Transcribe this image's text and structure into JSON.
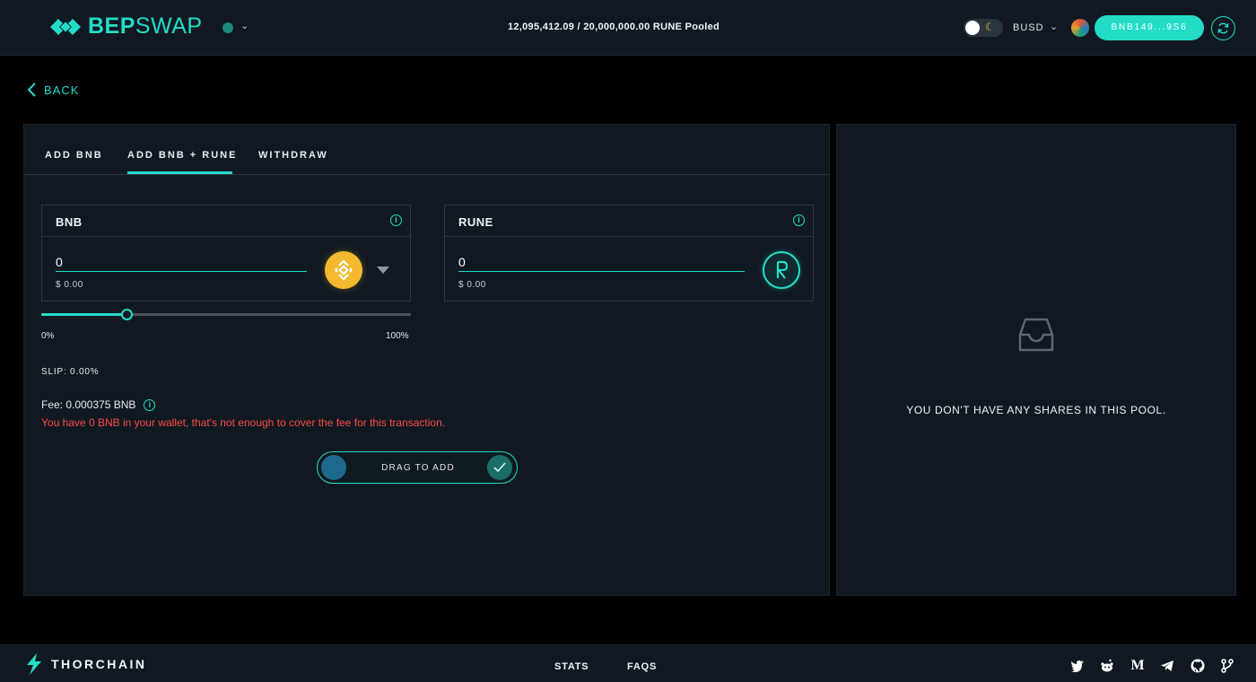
{
  "header": {
    "logo_bep": "BEP",
    "logo_swap": "SWAP",
    "pooled_text": "12,095,412.09 / 20,000,000.00 RUNE Pooled",
    "currency": "BUSD",
    "wallet_address": "BNB149...9S6"
  },
  "nav": {
    "back_label": "BACK"
  },
  "tabs": [
    {
      "label": "ADD BNB"
    },
    {
      "label": "ADD BNB + RUNE",
      "active": true
    },
    {
      "label": "WITHDRAW"
    }
  ],
  "bnb_card": {
    "title": "BNB",
    "amount": "0",
    "usd": "$ 0.00",
    "icon": "bnb-coin-icon"
  },
  "rune_card": {
    "title": "RUNE",
    "amount": "0",
    "usd": "$ 0.00",
    "icon": "rune-coin-icon"
  },
  "slider": {
    "min_label": "0%",
    "max_label": "100%",
    "value_fraction": 0.23
  },
  "slip_text": "SLIP: 0.00%",
  "fee": {
    "text": "Fee: 0.000375 BNB",
    "warning": "You have 0 BNB in your wallet, that's not enough to cover the fee for this transaction."
  },
  "drag_button": {
    "label": "DRAG TO ADD"
  },
  "shares_panel": {
    "empty_text": "YOU DON'T HAVE ANY SHARES IN THIS POOL.",
    "icon": "inbox-icon"
  },
  "footer": {
    "brand": "THORCHAIN",
    "links": [
      "STATS",
      "FAQS"
    ],
    "social_icons": [
      "twitter-icon",
      "reddit-icon",
      "medium-icon",
      "telegram-icon",
      "github-icon",
      "branch-icon"
    ]
  },
  "colors": {
    "accent": "#23dcc8",
    "warning": "#ff4b48",
    "panel": "#101921",
    "bnb": "#f3ba2f"
  }
}
